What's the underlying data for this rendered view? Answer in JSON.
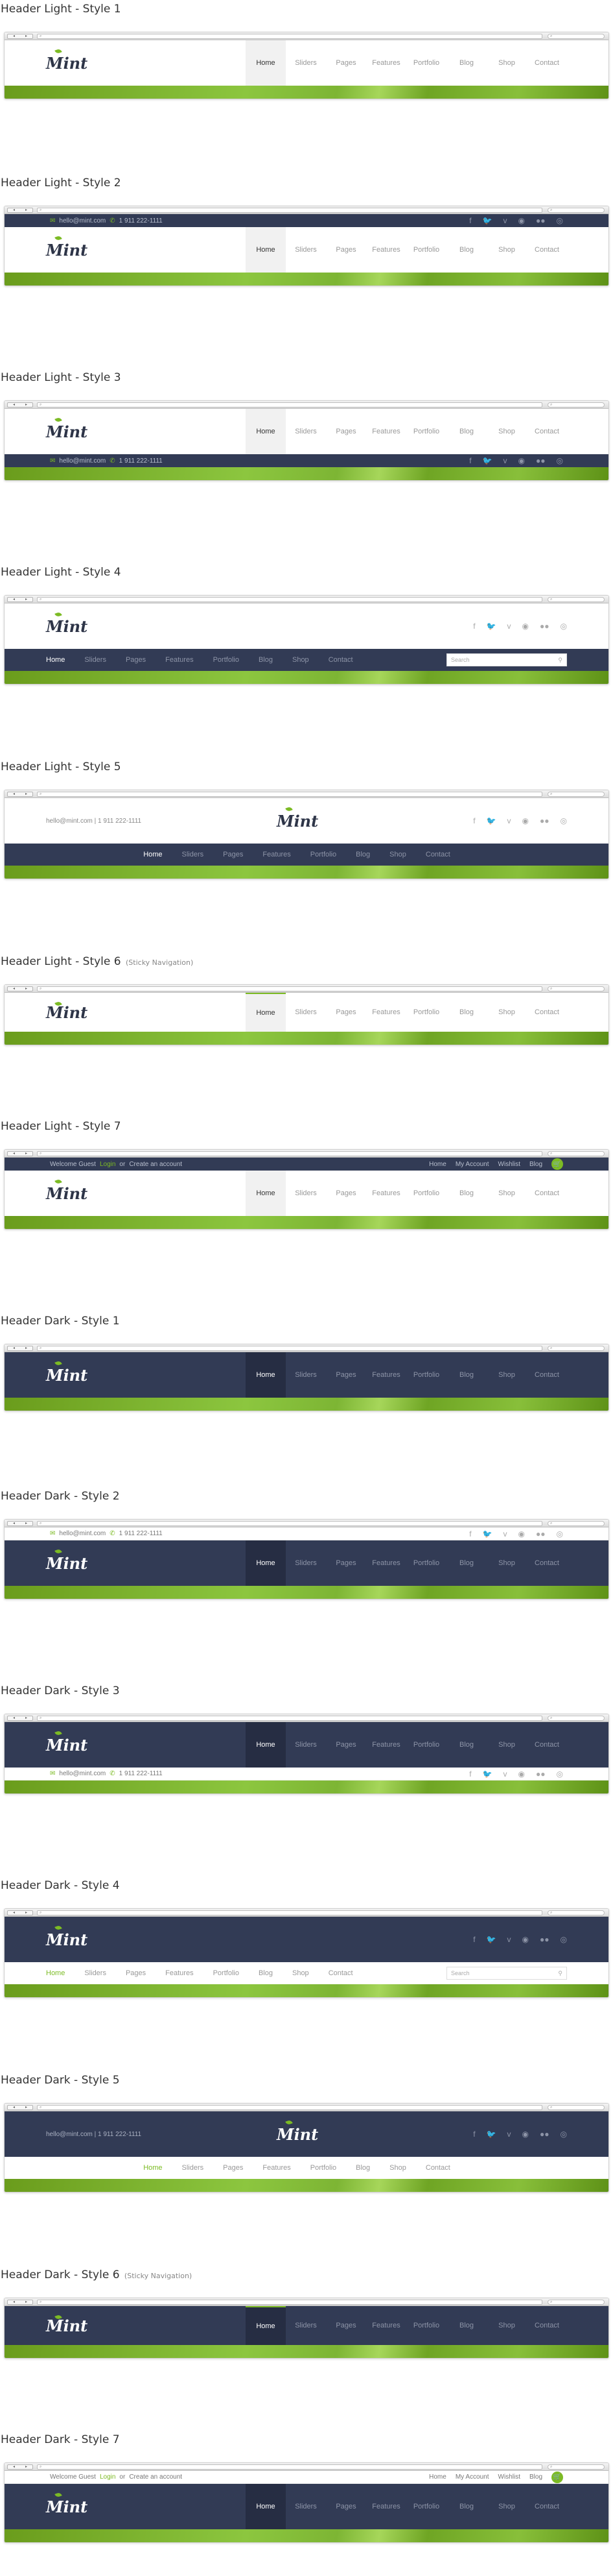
{
  "chrome": {
    "nav_back": "◂",
    "nav_fwd": "▸",
    "url": "⌕",
    "search": "⌕"
  },
  "logo": "Mint",
  "menu": [
    "Home",
    "Sliders",
    "Pages",
    "Features",
    "Portfolio",
    "Blog",
    "Shop",
    "Contact"
  ],
  "contact": {
    "email": "hello@mint.com",
    "phone": "1 911 222-1111",
    "email_icon": "✉",
    "phone_icon": "✆",
    "divider": "|"
  },
  "social": [
    "f",
    "t",
    "v",
    "d",
    "ff",
    "rss"
  ],
  "search_placeholder": "Search",
  "topbar7": {
    "welcome": "Welcome Guest",
    "login": "Login",
    "or": "or",
    "create": "Create an account",
    "links": [
      "Home",
      "My Account",
      "Wishlist",
      "Blog"
    ]
  },
  "sections": [
    {
      "title": "Header Light - Style 1",
      "note": ""
    },
    {
      "title": "Header Light - Style 2",
      "note": ""
    },
    {
      "title": "Header Light - Style 3",
      "note": ""
    },
    {
      "title": "Header Light - Style 4",
      "note": ""
    },
    {
      "title": "Header Light - Style 5",
      "note": ""
    },
    {
      "title": "Header Light - Style 6",
      "note": "(Sticky Navigation)"
    },
    {
      "title": "Header Light - Style 7",
      "note": ""
    },
    {
      "title": "Header Dark - Style 1",
      "note": ""
    },
    {
      "title": "Header Dark - Style 2",
      "note": ""
    },
    {
      "title": "Header Dark - Style 3",
      "note": ""
    },
    {
      "title": "Header Dark - Style 4",
      "note": ""
    },
    {
      "title": "Header Dark - Style 5",
      "note": ""
    },
    {
      "title": "Header Dark - Style 6",
      "note": "(Sticky Navigation)"
    },
    {
      "title": "Header Dark - Style 7",
      "note": ""
    }
  ],
  "colors": {
    "accent": "#7cbb24",
    "dark": "#323b55"
  }
}
